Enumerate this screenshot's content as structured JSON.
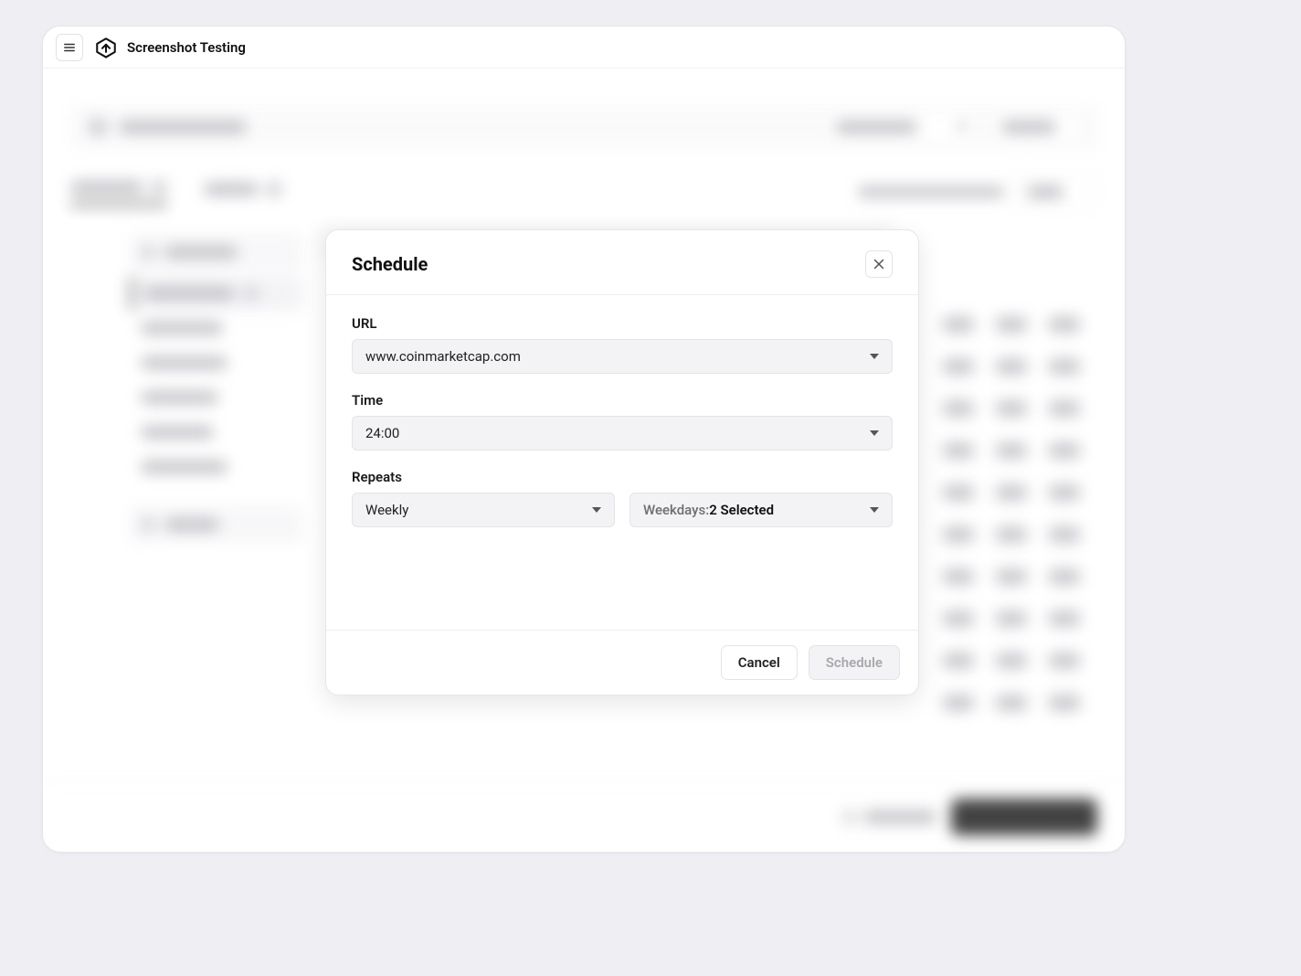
{
  "header": {
    "title": "Screenshot Testing"
  },
  "modal": {
    "title": "Schedule",
    "url": {
      "label": "URL",
      "value": "www.coinmarketcap.com"
    },
    "time": {
      "label": "Time",
      "value": "24:00"
    },
    "repeats": {
      "label": "Repeats",
      "frequency": "Weekly",
      "weekdays_prefix": "Weekdays: ",
      "weekdays_value": "2 Selected"
    },
    "actions": {
      "cancel": "Cancel",
      "schedule": "Schedule"
    }
  }
}
